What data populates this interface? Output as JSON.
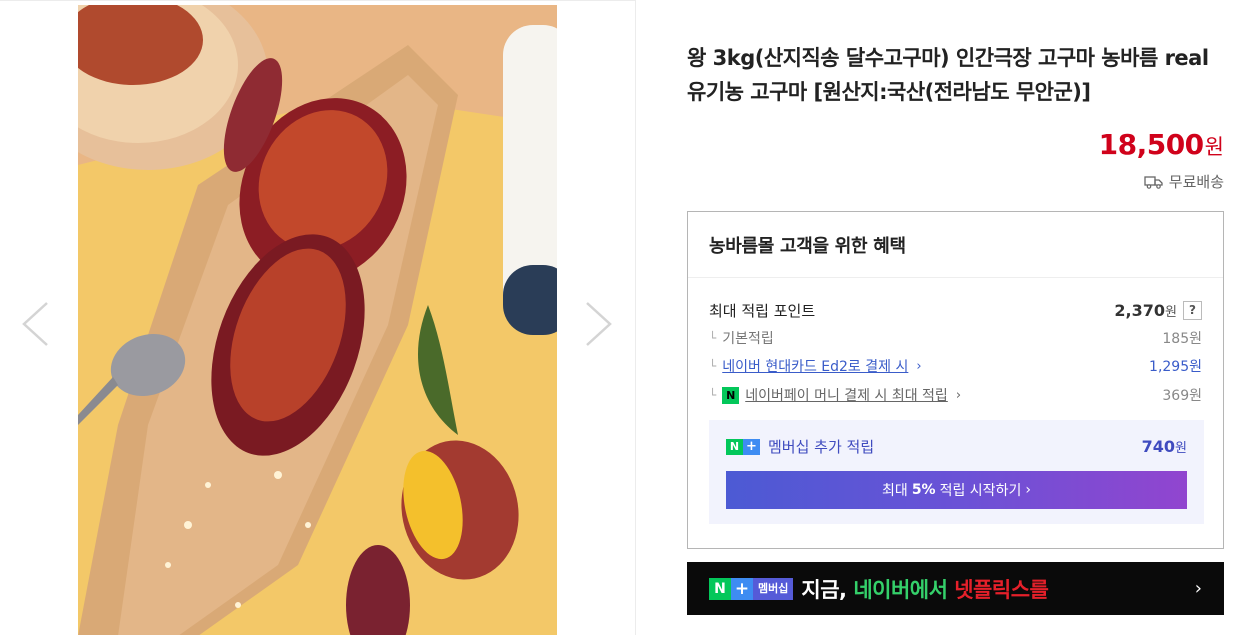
{
  "gallery": {
    "prev_icon": "chevron-left-icon",
    "next_icon": "chevron-right-icon"
  },
  "product": {
    "title": "왕 3kg(산지직송 달수고구마) 인간극장 고구마 농바름 real 유기농 고구마 [원산지:국산(전라남도 무안군)]",
    "price": "18,500",
    "price_unit": "원",
    "shipping": "무료배송",
    "shipping_icon": "truck-icon",
    "price_color": "#d0021b"
  },
  "benefits": {
    "heading": "농바름몰 고객을 위한 혜택",
    "max_points_label": "최대 적립 포인트",
    "max_points_value": "2,370",
    "max_points_unit": "원",
    "help_label": "?",
    "rows": [
      {
        "tick": "└",
        "label": "기본적립",
        "value": "185원"
      },
      {
        "tick": "└",
        "label": "네이버 현대카드 Ed2로 결제 시",
        "value": "1,295원"
      },
      {
        "tick": "└",
        "label": "네이버페이 머니 결제 시 최대 적립",
        "value": "369원"
      }
    ],
    "npay_badge": "N"
  },
  "membership": {
    "badge_n": "N",
    "badge_plus": "+",
    "label": "멤버십 추가 적립",
    "value": "740",
    "unit": "원",
    "button_prefix": "최대 ",
    "button_bold": "5%",
    "button_suffix": " 적립 시작하기",
    "accent": "#3f4bbf"
  },
  "banner": {
    "badge_n": "N",
    "badge_plus": "+",
    "badge_text": "멤버십",
    "text_1": "지금, ",
    "text_2": "네이버에서 ",
    "text_3": "넷플릭스를",
    "chevron": "›"
  }
}
